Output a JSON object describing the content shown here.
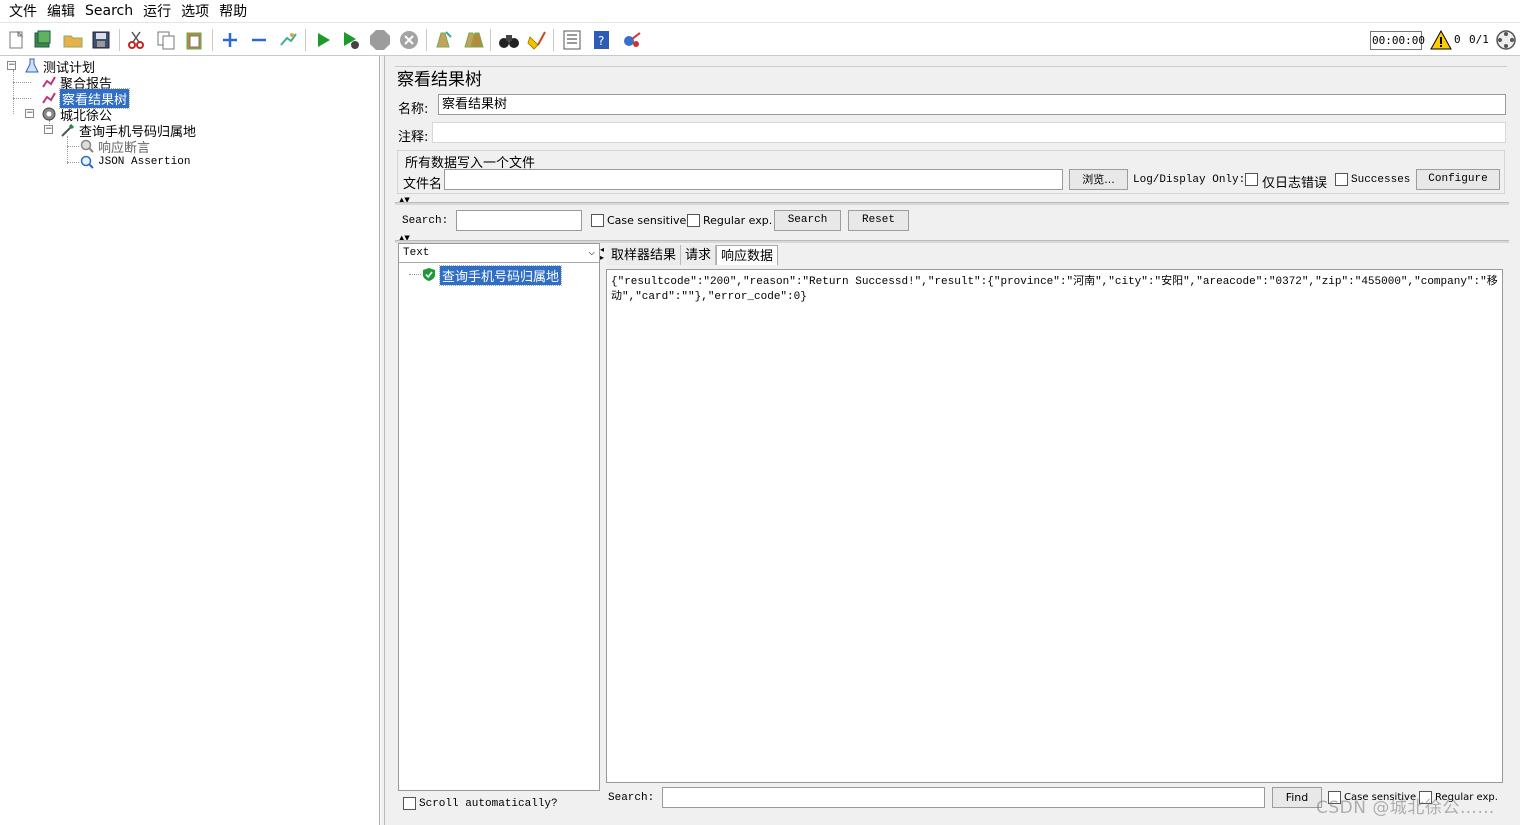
{
  "menu": {
    "file": "文件",
    "edit": "编辑",
    "search": "Search",
    "run": "运行",
    "options": "选项",
    "help": "帮助"
  },
  "toolbar": {
    "timer": "00:00:00",
    "warning_count": "0",
    "thread_ratio": "0/1"
  },
  "tree": {
    "root": "测试计划",
    "items": [
      {
        "label": "聚合报告"
      },
      {
        "label": "察看结果树"
      },
      {
        "label": "城北徐公"
      },
      {
        "label": "查询手机号码归属地"
      },
      {
        "label": "响应断言"
      },
      {
        "label": "JSON Assertion"
      }
    ]
  },
  "panel": {
    "title": "察看结果树",
    "name_label": "名称:",
    "name_value": "察看结果树",
    "comment_label": "注释:",
    "comment_value": "",
    "file_group_title": "所有数据写入一个文件",
    "filename_label": "文件名",
    "filename_value": "",
    "browse_button": "浏览...",
    "log_display_label": "Log/Display Only:",
    "errors_only_label": "仅日志错误",
    "successes_label": "Successes",
    "configure_button": "Configure"
  },
  "search_bar": {
    "label": "Search:",
    "value": "",
    "case_sensitive": "Case sensitive",
    "regular_exp": "Regular exp.",
    "search_button": "Search",
    "reset_button": "Reset"
  },
  "results": {
    "renderer": "Text",
    "sample_label": "查询手机号码归属地",
    "scroll_auto": "Scroll automatically?",
    "tabs": [
      "取样器结果",
      "请求",
      "响应数据"
    ],
    "response_text": "{\"resultcode\":\"200\",\"reason\":\"Return Successd!\",\"result\":{\"province\":\"河南\",\"city\":\"安阳\",\"areacode\":\"0372\",\"zip\":\"455000\",\"company\":\"移动\",\"card\":\"\"},\"error_code\":0}",
    "bottom_search_label": "Search:",
    "bottom_search_value": "",
    "find_button": "Find",
    "bottom_case_sensitive": "Case sensitive",
    "bottom_regular_exp": "Regular exp."
  },
  "watermark": "CSDN @城北徐公……"
}
